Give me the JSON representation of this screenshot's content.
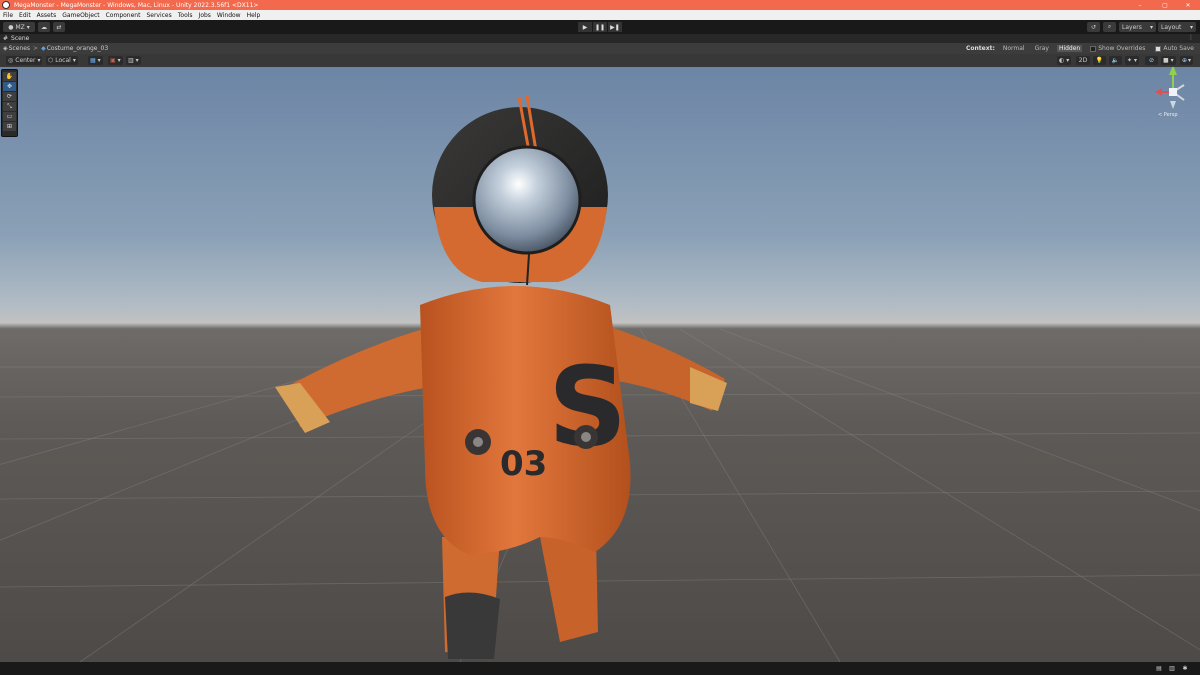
{
  "window": {
    "title": "MegaMonster - MegaMonster - Windows, Mac, Linux - Unity 2022.3.56f1 <DX11>",
    "controls": [
      "–",
      "▢",
      "✕"
    ]
  },
  "menu": [
    "File",
    "Edit",
    "Assets",
    "GameObject",
    "Component",
    "Services",
    "Tools",
    "Jobs",
    "Window",
    "Help"
  ],
  "toolbar": {
    "account_label": "MZ",
    "play_icons": [
      "▶",
      "❚❚",
      "▶❚"
    ],
    "layers_label": "Layers",
    "layout_label": "Layout"
  },
  "scene_tab": {
    "label": "Scene",
    "menu_glyph": "⋮"
  },
  "breadcrumb": {
    "root": "Scenes",
    "separator": ">",
    "current": "Costume_orange_03"
  },
  "context": {
    "label": "Context:",
    "options": [
      "Normal",
      "Gray",
      "Hidden"
    ],
    "selected": "Hidden",
    "show_overrides": "Show Overrides",
    "auto_save": "Auto Save"
  },
  "scene_toolbar": {
    "pivot_label": "Center",
    "space_label": "Local",
    "mode_2d": "2D"
  },
  "tools": [
    "✋",
    "✥",
    "⟳",
    "⤡",
    "▭",
    "⊞"
  ],
  "gizmo": {
    "projection_label": "< Persp"
  },
  "character": {
    "chest_letter": "S",
    "chest_number": "03"
  },
  "colors": {
    "titlebar": "#f2694e",
    "suit": "#d9692f",
    "helmet": "#2c2b2b"
  }
}
